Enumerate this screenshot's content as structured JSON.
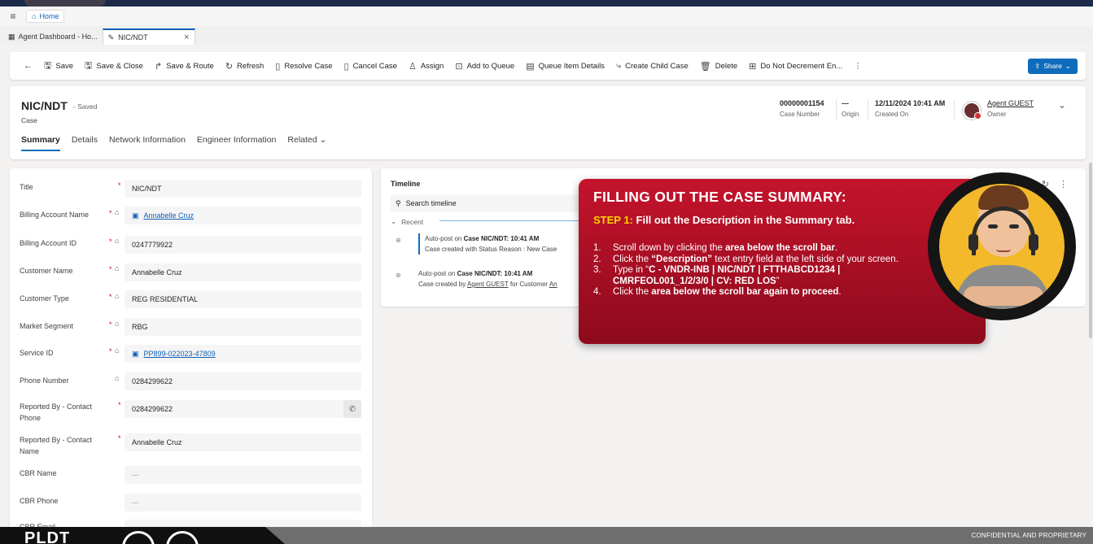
{
  "nav": {
    "home_label": "Home",
    "menu_icon": "hamburger-icon",
    "home_icon": "home-icon"
  },
  "app_tabs": [
    {
      "label": "Agent Dashboard - Ho..."
    },
    {
      "label": "NIC/NDT"
    }
  ],
  "commands": {
    "save": "Save",
    "save_close": "Save & Close",
    "save_route": "Save & Route",
    "refresh": "Refresh",
    "resolve": "Resolve Case",
    "cancel": "Cancel Case",
    "assign": "Assign",
    "add_queue": "Add to Queue",
    "queue_details": "Queue Item Details",
    "child_case": "Create Child Case",
    "delete": "Delete",
    "do_not_decrement": "Do Not Decrement En...",
    "more": "⋮",
    "share": "Share"
  },
  "record": {
    "title": "NIC/NDT",
    "saved": "- Saved",
    "entity": "Case",
    "tabs": [
      "Summary",
      "Details",
      "Network Information",
      "Engineer Information",
      "Related"
    ],
    "header_fields": {
      "case_number": {
        "value": "00000001154",
        "label": "Case Number"
      },
      "origin": {
        "value": "---",
        "label": "Origin"
      },
      "created_on": {
        "value": "12/11/2024 10:41 AM",
        "label": "Created On"
      },
      "owner": {
        "value": "Agent GUEST",
        "label": "Owner"
      }
    }
  },
  "form": {
    "title": {
      "label": "Title",
      "value": "NIC/NDT"
    },
    "billing_account_name": {
      "label": "Billing Account Name",
      "value": "Annabelle Cruz"
    },
    "billing_account_id": {
      "label": "Billing Account ID",
      "value": "0247779922"
    },
    "customer_name": {
      "label": "Customer Name",
      "value": "Annabelle Cruz"
    },
    "customer_type": {
      "label": "Customer Type",
      "value": "REG RESIDENTIAL"
    },
    "market_segment": {
      "label": "Market Segment",
      "value": "RBG"
    },
    "service_id": {
      "label": "Service ID",
      "value": "PP899-022023-47809"
    },
    "phone_number": {
      "label": "Phone Number",
      "value": "0284299622"
    },
    "reported_by_phone": {
      "label": "Reported By - Contact Phone",
      "value": "0284299622"
    },
    "reported_by_name": {
      "label": "Reported By - Contact Name",
      "value": "Annabelle Cruz"
    },
    "cbr_name": {
      "label": "CBR Name",
      "value": "---"
    },
    "cbr_phone": {
      "label": "CBR Phone",
      "value": "---"
    },
    "cbr_email": {
      "label": "CBR Email"
    }
  },
  "timeline": {
    "title": "Timeline",
    "search_placeholder": "Search timeline",
    "recent_label": "Recent",
    "item1": {
      "prefix": "Auto-post on",
      "case_ref": "Case NIC/NDT:",
      "time": "10:41 AM",
      "body": "Case created with Status Reason : New Case"
    },
    "item2": {
      "prefix": "Auto-post on",
      "case_ref": "Case NIC/NDT:",
      "time": "10:41 AM",
      "body_a": "Case created by",
      "body_agent": "Agent GUEST",
      "body_b": "for Customer",
      "body_cust": "An"
    }
  },
  "overlay": {
    "title": "FILLING OUT THE CASE SUMMARY:",
    "step_label": "STEP 1:",
    "step_text": "Fill out the Description in the Summary tab.",
    "steps": [
      {
        "num": "1.",
        "a": "Scroll down by clicking the ",
        "b": "area below the scroll bar",
        "c": "."
      },
      {
        "num": "2.",
        "a": "Click the ",
        "b": "“Description”",
        "c": " text entry field at the left side of your screen."
      },
      {
        "num": "3.",
        "a": "Type in “",
        "b": "C - VNDR-INB | NIC/NDT | FTTHABCD1234 | CMRFEOL001_1/2/3/0 | CV: RED LOS",
        "c": "”"
      },
      {
        "num": "4.",
        "a": "Click the ",
        "b": "area below the scroll bar again to proceed",
        "c": "."
      }
    ]
  },
  "footer": {
    "brand": "PLDT",
    "confidential": "CONFIDENTIAL AND PROPRIETARY"
  },
  "colors": {
    "accent": "#0f6cbd",
    "overlay_red": "#c4142c",
    "step_yellow": "#ffd200"
  }
}
